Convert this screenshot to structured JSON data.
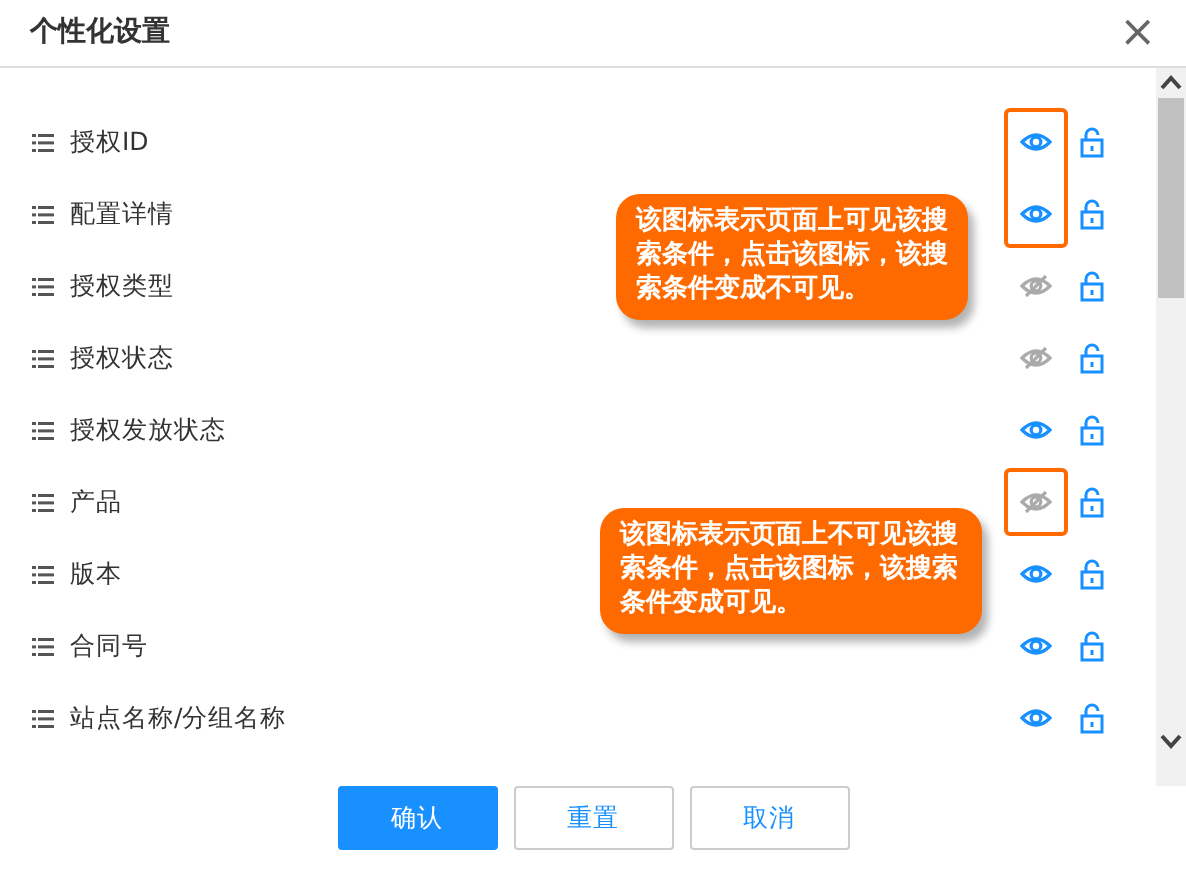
{
  "dialog": {
    "title": "个性化设置",
    "close": "×"
  },
  "fields": [
    {
      "label": "授权ID",
      "visible": true,
      "highlighted": true
    },
    {
      "label": "配置详情",
      "visible": true,
      "highlighted": true
    },
    {
      "label": "授权类型",
      "visible": false,
      "highlighted": false
    },
    {
      "label": "授权状态",
      "visible": false,
      "highlighted": false
    },
    {
      "label": "授权发放状态",
      "visible": true,
      "highlighted": false
    },
    {
      "label": "产品",
      "visible": false,
      "highlighted": true
    },
    {
      "label": "版本",
      "visible": true,
      "highlighted": false
    },
    {
      "label": "合同号",
      "visible": true,
      "highlighted": false
    },
    {
      "label": "站点名称/分组名称",
      "visible": true,
      "highlighted": false
    }
  ],
  "callouts": [
    {
      "text": "该图标表示页面上可见该搜索条件，点击该图标，该搜索条件变成不可见。"
    },
    {
      "text": "该图标表示页面上不可见该搜索条件，点击该图标，该搜索条件变成可见。"
    }
  ],
  "buttons": [
    {
      "label": "确认",
      "kind": "primary"
    },
    {
      "label": "重置",
      "kind": "default"
    },
    {
      "label": "取消",
      "kind": "default"
    }
  ]
}
